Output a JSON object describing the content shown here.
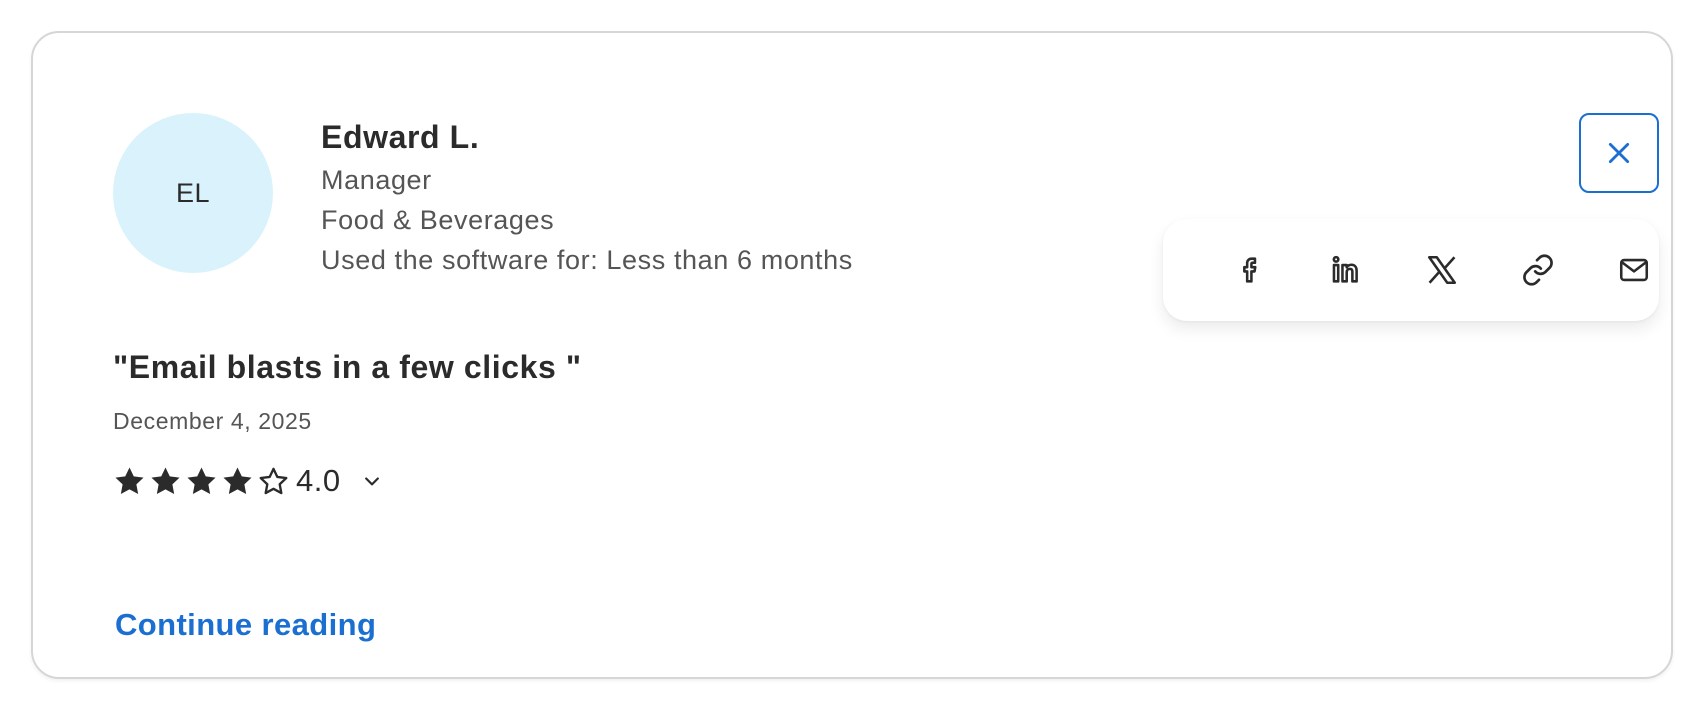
{
  "reviewer": {
    "initials": "EL",
    "name": "Edward L.",
    "role": "Manager",
    "industry": "Food & Beverages",
    "usage": "Used the software for: Less than 6 months"
  },
  "review": {
    "title": "\"Email blasts in a few clicks \"",
    "date": "December 4, 2025",
    "rating": {
      "value": "4.0",
      "stars_filled": 4,
      "stars_total": 5
    },
    "continue_label": "Continue reading"
  },
  "share": {
    "items": [
      {
        "icon": "facebook-icon"
      },
      {
        "icon": "linkedin-icon"
      },
      {
        "icon": "x-icon"
      },
      {
        "icon": "link-icon"
      },
      {
        "icon": "email-icon"
      }
    ]
  },
  "colors": {
    "accent": "#1a6fd1",
    "avatar_bg": "#d9f2fb",
    "text": "#2b2b2b",
    "muted": "#555555"
  }
}
